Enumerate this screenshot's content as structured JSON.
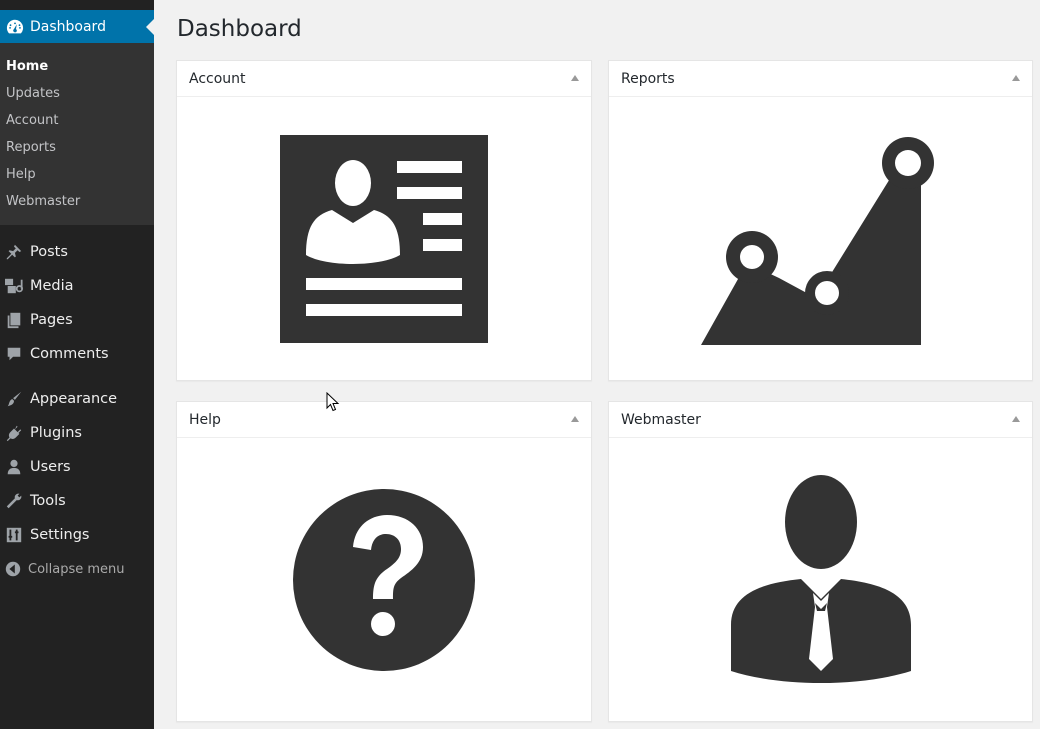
{
  "sidebar": {
    "dashboard_label": "Dashboard",
    "submenu": [
      {
        "label": "Home",
        "current": true
      },
      {
        "label": "Updates"
      },
      {
        "label": "Account"
      },
      {
        "label": "Reports"
      },
      {
        "label": "Help"
      },
      {
        "label": "Webmaster"
      }
    ],
    "menu": [
      {
        "label": "Posts",
        "icon": "pushpin-icon"
      },
      {
        "label": "Media",
        "icon": "media-icon"
      },
      {
        "label": "Pages",
        "icon": "pages-icon"
      },
      {
        "label": "Comments",
        "icon": "comment-icon"
      },
      {
        "label": "Appearance",
        "icon": "paintbrush-icon"
      },
      {
        "label": "Plugins",
        "icon": "plug-icon"
      },
      {
        "label": "Users",
        "icon": "user-icon"
      },
      {
        "label": "Tools",
        "icon": "wrench-icon"
      },
      {
        "label": "Settings",
        "icon": "settings-icon"
      }
    ],
    "collapse_label": "Collapse menu"
  },
  "main": {
    "title": "Dashboard",
    "panels": [
      {
        "title": "Account",
        "icon": "id-card-icon"
      },
      {
        "title": "Reports",
        "icon": "line-chart-icon"
      },
      {
        "title": "Help",
        "icon": "question-circle-icon"
      },
      {
        "title": "Webmaster",
        "icon": "businessman-icon"
      }
    ]
  },
  "colors": {
    "sidebar_bg": "#222222",
    "submenu_bg": "#333333",
    "accent": "#0073aa",
    "icon_fill": "#333333",
    "page_bg": "#f1f1f1"
  }
}
